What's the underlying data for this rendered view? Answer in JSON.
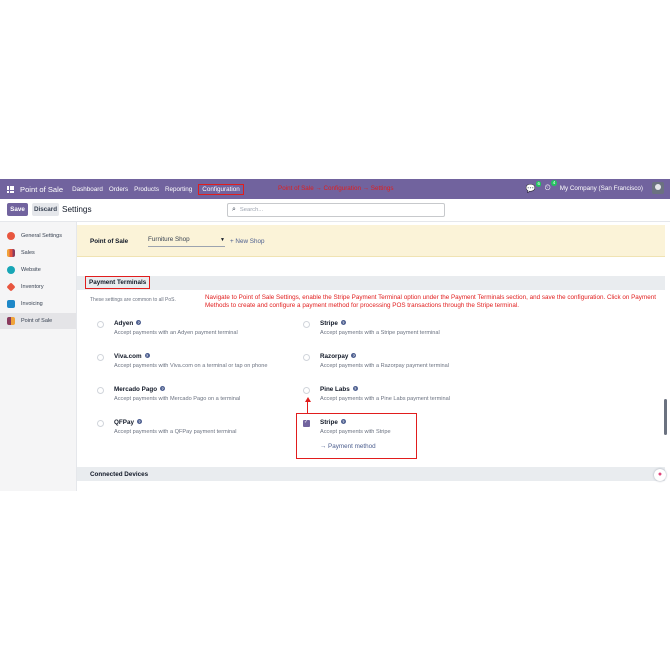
{
  "navbar": {
    "app_name": "Point of Sale",
    "menu": [
      "Dashboard",
      "Orders",
      "Products",
      "Reporting",
      "Configuration"
    ],
    "annotation": "Point of Sale → Configuration → Settings",
    "company": "My Company (San Francisco)",
    "chat_badge": "6",
    "activity_badge": "4"
  },
  "control_panel": {
    "save_label": "Save",
    "discard_label": "Discard",
    "title": "Settings",
    "search_placeholder": "Search..."
  },
  "sidebar": {
    "items": [
      {
        "label": "General Settings",
        "color": "#e8563f"
      },
      {
        "label": "Sales",
        "color": "#f0a33a"
      },
      {
        "label": "Website",
        "color": "#18a6b6"
      },
      {
        "label": "Inventory",
        "color": "#e8563f"
      },
      {
        "label": "Invoicing",
        "color": "#1e88c8"
      },
      {
        "label": "Point of Sale",
        "color": "#8a3b5e"
      }
    ],
    "active_index": 5
  },
  "pos_bar": {
    "label": "Point of Sale",
    "shop_value": "Furniture Shop",
    "new_shop_label": "+ New Shop"
  },
  "payment_terminals": {
    "title": "Payment Terminals",
    "note": "These settings are common to all PoS.",
    "annotation": "Navigate to Point of Sale Settings, enable the Stripe Payment Terminal option under the Payment Terminals section, and save the configuration. Click on Payment Methods to create and configure a payment method for processing POS transactions through the Stripe terminal.",
    "settings": [
      {
        "title": "Adyen",
        "desc": "Accept payments with an Adyen payment terminal",
        "checked": false
      },
      {
        "title": "Stripe",
        "desc": "Accept payments with a Stripe payment terminal",
        "checked": false
      },
      {
        "title": "Viva.com",
        "desc": "Accept payments with Viva.com on a terminal or tap on phone",
        "checked": false
      },
      {
        "title": "Razorpay",
        "desc": "Accept payments with a Razorpay payment terminal",
        "checked": false
      },
      {
        "title": "Mercado Pago",
        "desc": "Accept payments with Mercado Pago on a terminal",
        "checked": false
      },
      {
        "title": "Pine Labs",
        "desc": "Accept payments with a Pine Labs payment terminal",
        "checked": false
      },
      {
        "title": "QFPay",
        "desc": "Accept payments with a QFPay payment terminal",
        "checked": false
      },
      {
        "title": "Stripe",
        "desc": "Accept payments with Stripe",
        "checked": true,
        "link": "→ Payment method"
      }
    ]
  },
  "connected_devices": {
    "title": "Connected Devices"
  },
  "colors": {
    "navbar": "#71639e",
    "annotation_red": "#e11d1d",
    "link_blue": "#4b5d8e"
  }
}
